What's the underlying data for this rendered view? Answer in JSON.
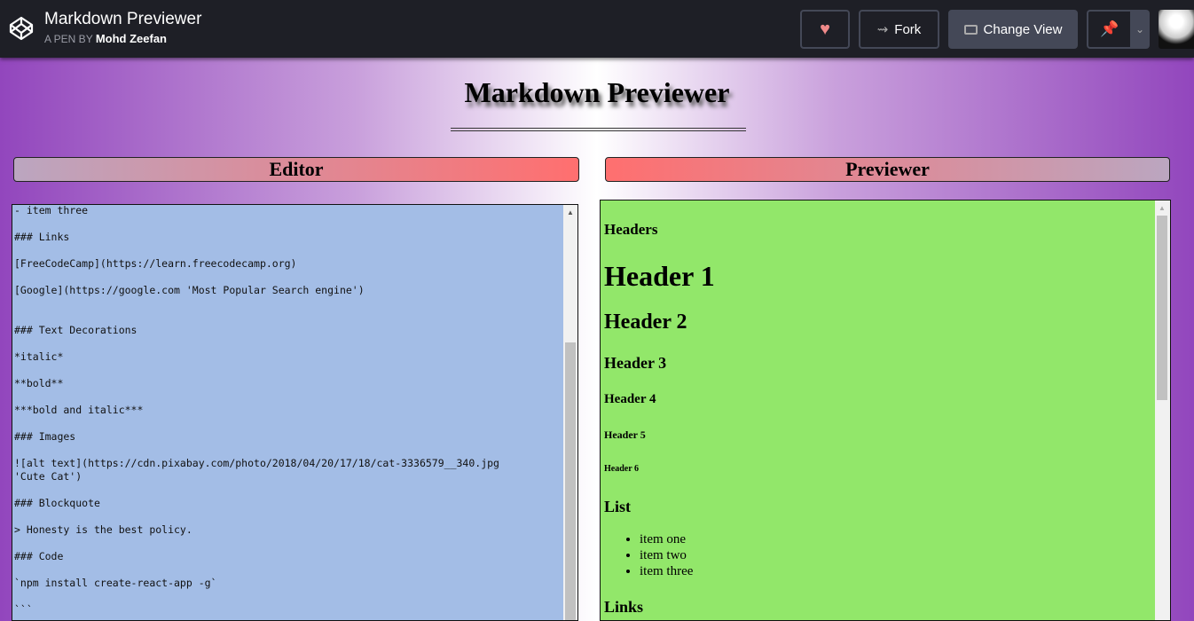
{
  "topbar": {
    "title": "Markdown Previewer",
    "by_label": "A PEN BY",
    "author": "Mohd Zeefan",
    "fork": "Fork",
    "change_view": "Change View"
  },
  "page": {
    "title": "Markdown Previewer",
    "editor_heading": "Editor",
    "previewer_heading": "Previewer"
  },
  "editor": {
    "lines": [
      "- item three",
      "",
      "### Links",
      "",
      "[FreeCodeCamp](https://learn.freecodecamp.org)",
      "",
      "[Google](https://google.com 'Most Popular Search engine')",
      "",
      "",
      "### Text Decorations",
      "",
      "*italic*",
      "",
      "**bold**",
      "",
      "***bold and italic***",
      "",
      "### Images",
      "",
      "![alt text](https://cdn.pixabay.com/photo/2018/04/20/17/18/cat-3336579__340.jpg",
      "'Cute Cat')",
      "",
      "### Blockquote",
      "",
      "> Honesty is the best policy.",
      "",
      "### Code",
      "",
      "`npm install create-react-app -g`",
      "",
      "```"
    ]
  },
  "preview": {
    "headers": "Headers",
    "h1": "Header 1",
    "h2": "Header 2",
    "h3": "Header 3",
    "h4": "Header 4",
    "h5": "Header 5",
    "h6": "Header 6",
    "list": "List",
    "items": [
      "item one",
      "item two",
      "item three"
    ],
    "links": "Links"
  },
  "colors": {
    "editor_bg": "#a3bde6",
    "preview_bg": "#92e76a",
    "heart": "#f08a8a",
    "pin": "#4fc3f7"
  }
}
